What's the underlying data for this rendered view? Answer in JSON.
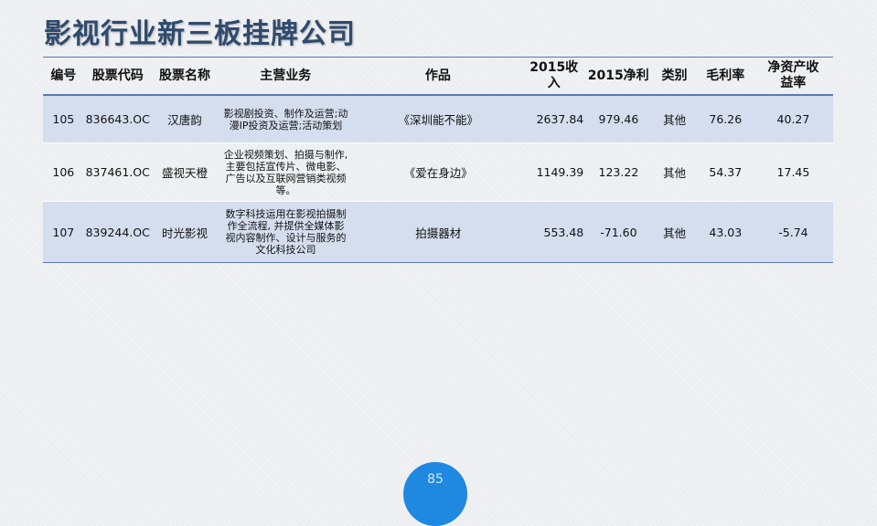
{
  "title": "影视行业新三板挂牌公司",
  "table": {
    "headers": [
      "编号",
      "股票代码",
      "股票名称",
      "主营业务",
      "作品",
      "2015收入",
      "2015净利",
      "类别",
      "毛利率",
      "净资产收益率"
    ],
    "header_roe_line1": "净资产收",
    "header_roe_line2": "益率",
    "rows": [
      {
        "id": "105",
        "code": "836643.OC",
        "name": "汉唐韵",
        "business": "影视剧投资、制作及运营;动漫IP投资及运营;活动策划",
        "works": "《深圳能不能》",
        "revenue": "2637.84",
        "profit": "979.46",
        "category": "其他",
        "gross_margin": "76.26",
        "roe": "40.27"
      },
      {
        "id": "106",
        "code": "837461.OC",
        "name": "盛视天橙",
        "business": "企业视频策划、拍摄与制作,主要包括宣传片、微电影、广告以及互联网营销类视频等。",
        "works": "《爱在身边》",
        "revenue": "1149.39",
        "profit": "123.22",
        "category": "其他",
        "gross_margin": "54.37",
        "roe": "17.45"
      },
      {
        "id": "107",
        "code": "839244.OC",
        "name": "时光影视",
        "business": "数字科技运用在影视拍摄制作全流程, 并提供全媒体影视内容制作、设计与服务的文化科技公司",
        "works": "拍摄器材",
        "revenue": "553.48",
        "profit": "-71.60",
        "category": "其他",
        "gross_margin": "43.03",
        "roe": "-5.74"
      }
    ]
  },
  "page_number": "85",
  "colors": {
    "title": "#2f4a6d",
    "rule": "#5a78b8",
    "row_shade": "#d5deee",
    "page_badge": "#1f88e0"
  }
}
